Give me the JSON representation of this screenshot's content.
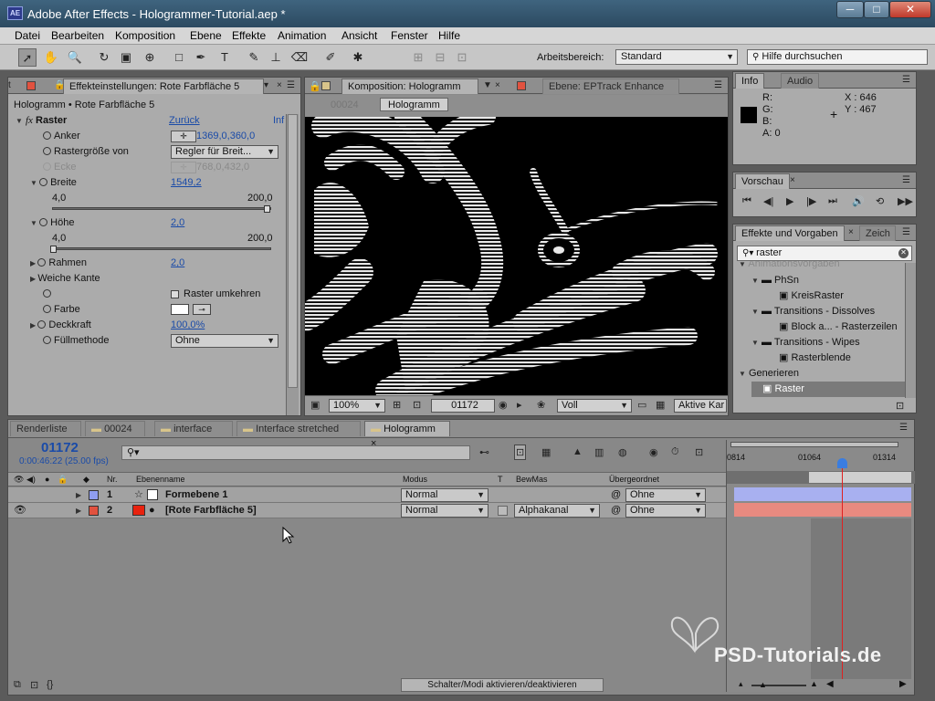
{
  "window": {
    "title": "Adobe After Effects - Hologrammer-Tutorial.aep *",
    "app_icon": "AE",
    "minimize": "─",
    "maximize": "□",
    "close": "✕"
  },
  "menu": [
    "Datei",
    "Bearbeiten",
    "Komposition",
    "Ebene",
    "Effekte",
    "Animation",
    "Ansicht",
    "Fenster",
    "Hilfe"
  ],
  "toolbar": {
    "workspace_label": "Arbeitsbereich:",
    "workspace_value": "Standard",
    "search_placeholder": "Hilfe durchsuchen"
  },
  "effects_panel": {
    "tab": "Effekteinstellungen: Rote Farbfläche 5",
    "breadcrumb": "Hologramm • Rote Farbfläche 5",
    "effect": {
      "name": "Raster",
      "reset": "Zurück",
      "info": "Inf"
    },
    "props": [
      {
        "label": "Anker",
        "value": "1369,0,360,0"
      },
      {
        "label": "Rastergröße von",
        "value": "Regler für Breit..."
      },
      {
        "label": "Ecke",
        "value": "768,0,432,0"
      },
      {
        "label": "Breite",
        "value": "1549,2",
        "min": "4,0",
        "max": "200,0",
        "level": 1.0
      },
      {
        "label": "Höhe",
        "value": "2,0",
        "min": "4,0",
        "max": "200,0",
        "level": 0.0
      },
      {
        "label": "Rahmen",
        "value": "2,0"
      },
      {
        "label": "Weiche Kante",
        "value": ""
      },
      {
        "label": "",
        "value": "Raster umkehren"
      },
      {
        "label": "Farbe",
        "value": ""
      },
      {
        "label": "Deckkraft",
        "value": "100,0%"
      },
      {
        "label": "Füllmethode",
        "value": "Ohne"
      }
    ],
    "colors": {
      "link": "#1a4ba8"
    }
  },
  "comp_panel": {
    "tab1": "Komposition: Hologramm",
    "tab2": "Ebene: EPTrack Enhance",
    "frame_label": "00024",
    "sub_tab": "Hologramm",
    "zoom": "100%",
    "timecode": "01172",
    "resolution": "Voll",
    "camera": "Aktive Kar"
  },
  "info_panel": {
    "tab1": "Info",
    "tab2": "Audio",
    "r": "R:",
    "g": "G:",
    "b": "B:",
    "a": "A: 0",
    "x": "X : 646",
    "y": "Y : 467"
  },
  "preview_panel": {
    "tab": "Vorschau"
  },
  "effects_presets": {
    "tab1": "Effekte und Vorgaben",
    "tab2": "Zeich",
    "search": "raster",
    "tree": [
      {
        "label": "Animationsvorgaben",
        "level": 0,
        "type": "folder"
      },
      {
        "label": "PhSn",
        "level": 1,
        "type": "folder"
      },
      {
        "label": "KreisRaster",
        "level": 2,
        "type": "preset"
      },
      {
        "label": "Transitions - Dissolves",
        "level": 1,
        "type": "folder"
      },
      {
        "label": "Block a... - Rasterzeilen",
        "level": 2,
        "type": "preset"
      },
      {
        "label": "Transitions - Wipes",
        "level": 1,
        "type": "folder"
      },
      {
        "label": "Rasterblende",
        "level": 2,
        "type": "preset"
      },
      {
        "label": "Generieren",
        "level": 0,
        "type": "folder"
      },
      {
        "label": "Raster",
        "level": 1,
        "type": "effect",
        "selected": true
      }
    ]
  },
  "timeline": {
    "tabs": [
      "Renderliste",
      "00024",
      "interface",
      "Interface stretched",
      "Hologramm"
    ],
    "timecode": "01172",
    "fps": "0:00:46:22 (25.00 fps)",
    "columns": {
      "nr": "Nr.",
      "name": "Ebenenname",
      "modus": "Modus",
      "t": "T",
      "bewmas": "BewMas",
      "parent": "Übergeordnet"
    },
    "layers": [
      {
        "nr": "1",
        "name": "Formebene 1",
        "mode": "Normal",
        "bewmas": "",
        "parent": "Ohne",
        "color": "#8f9df0"
      },
      {
        "nr": "2",
        "name": "[Rote Farbfläche 5]",
        "mode": "Normal",
        "bewmas": "Alphakanal",
        "parent": "Ohne",
        "color": "#e2523f"
      }
    ],
    "ruler": [
      "0814",
      "01064",
      "01314"
    ],
    "footer": "Schalter/Modi aktivieren/deaktivieren"
  },
  "watermark": "PSD-Tutorials.de"
}
